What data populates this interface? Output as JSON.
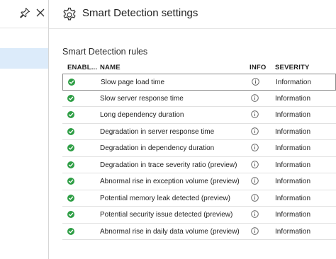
{
  "blade": {
    "title": "Smart Detection settings"
  },
  "section": {
    "title": "Smart Detection rules"
  },
  "table": {
    "headers": {
      "enabled": "ENABL...",
      "name": "NAME",
      "info": "INFO",
      "severity": "SEVERITY"
    },
    "rows": [
      {
        "name": "Slow page load time",
        "severity": "Information",
        "enabled": true
      },
      {
        "name": "Slow server response time",
        "severity": "Information",
        "enabled": true
      },
      {
        "name": "Long dependency duration",
        "severity": "Information",
        "enabled": true
      },
      {
        "name": "Degradation in server response time",
        "severity": "Information",
        "enabled": true
      },
      {
        "name": "Degradation in dependency duration",
        "severity": "Information",
        "enabled": true
      },
      {
        "name": "Degradation in trace severity ratio (preview)",
        "severity": "Information",
        "enabled": true
      },
      {
        "name": "Abnormal rise in exception volume (preview)",
        "severity": "Information",
        "enabled": true
      },
      {
        "name": "Potential memory leak detected (preview)",
        "severity": "Information",
        "enabled": true
      },
      {
        "name": "Potential security issue detected (preview)",
        "severity": "Information",
        "enabled": true
      },
      {
        "name": "Abnormal rise in daily data volume (preview)",
        "severity": "Information",
        "enabled": true
      }
    ]
  },
  "colors": {
    "enabled_check": "#2e9e45",
    "selected_nav": "#dcebfa",
    "border": "#e1e1e1"
  },
  "icons": {
    "pin": "pin-icon",
    "close": "close-icon",
    "gear": "gear-icon",
    "info": "info-icon",
    "check": "check-circle-icon"
  }
}
